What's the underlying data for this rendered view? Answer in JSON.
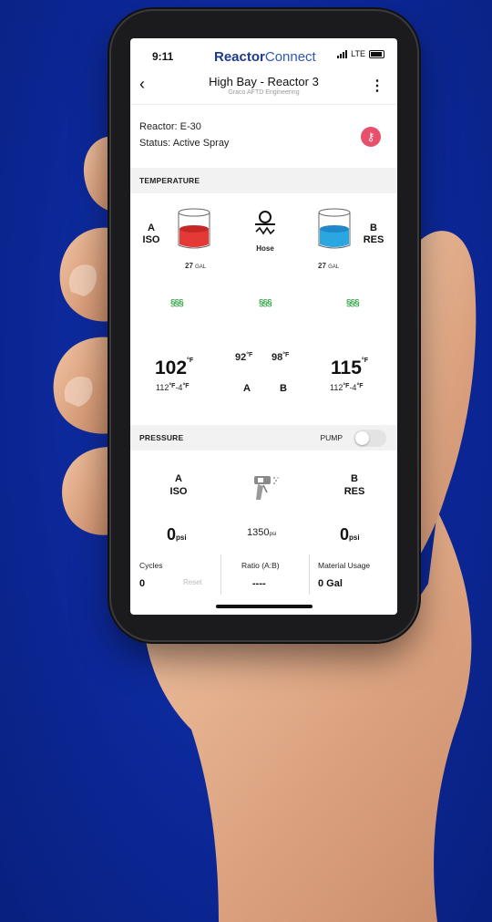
{
  "status_bar": {
    "time": "9:11",
    "network": "LTE"
  },
  "brand": {
    "part1": "Reactor",
    "part2": "Connect"
  },
  "nav": {
    "title": "High Bay -  Reactor 3",
    "subtitle": "Graco AFTD Engineering",
    "back_glyph": "‹",
    "menu_glyph": "⋮"
  },
  "reactor": {
    "model_line": "Reactor: E-30",
    "status_line": "Status: Active Spray"
  },
  "temperature": {
    "section_label": "TEMPERATURE",
    "iso": {
      "letter": "A",
      "name": "ISO",
      "gallons": "27",
      "gal_unit": "GAL",
      "temp": "102",
      "setpoint": "112",
      "deadband": "-4",
      "color": "#e53935"
    },
    "hose": {
      "label": "Hose",
      "temp_a": "92",
      "temp_b": "98",
      "label_a": "A",
      "label_b": "B"
    },
    "res": {
      "letter": "B",
      "name": "RES",
      "gallons": "27",
      "gal_unit": "GAL",
      "temp": "115",
      "setpoint": "112",
      "deadband": "-4",
      "color": "#2aa6e0"
    },
    "unit": "°F",
    "heater_glyph": "§§§"
  },
  "pressure": {
    "section_label": "PRESSURE",
    "pump_label": "PUMP",
    "iso": {
      "letter": "A",
      "name": "ISO",
      "value": "0",
      "unit": "psi"
    },
    "gun": {
      "value": "1350",
      "unit": "psi"
    },
    "res": {
      "letter": "B",
      "name": "RES",
      "value": "0",
      "unit": "psi"
    }
  },
  "stats": {
    "cycles": {
      "label": "Cycles",
      "value": "0",
      "reset": "Reset"
    },
    "ratio": {
      "label": "Ratio (A:B)",
      "value": "----"
    },
    "material": {
      "label": "Material Usage",
      "value": "0 Gal"
    }
  },
  "colors": {
    "background": "#0c2899",
    "accent": "#e7506a",
    "heater": "#3aa84d",
    "brand": "#1d3a8a"
  },
  "icons": [
    "back-chevron-icon",
    "kebab-menu-icon",
    "key-icon",
    "hose-heater-icon",
    "heater-icon",
    "spray-gun-icon",
    "signal-icon",
    "battery-icon"
  ]
}
